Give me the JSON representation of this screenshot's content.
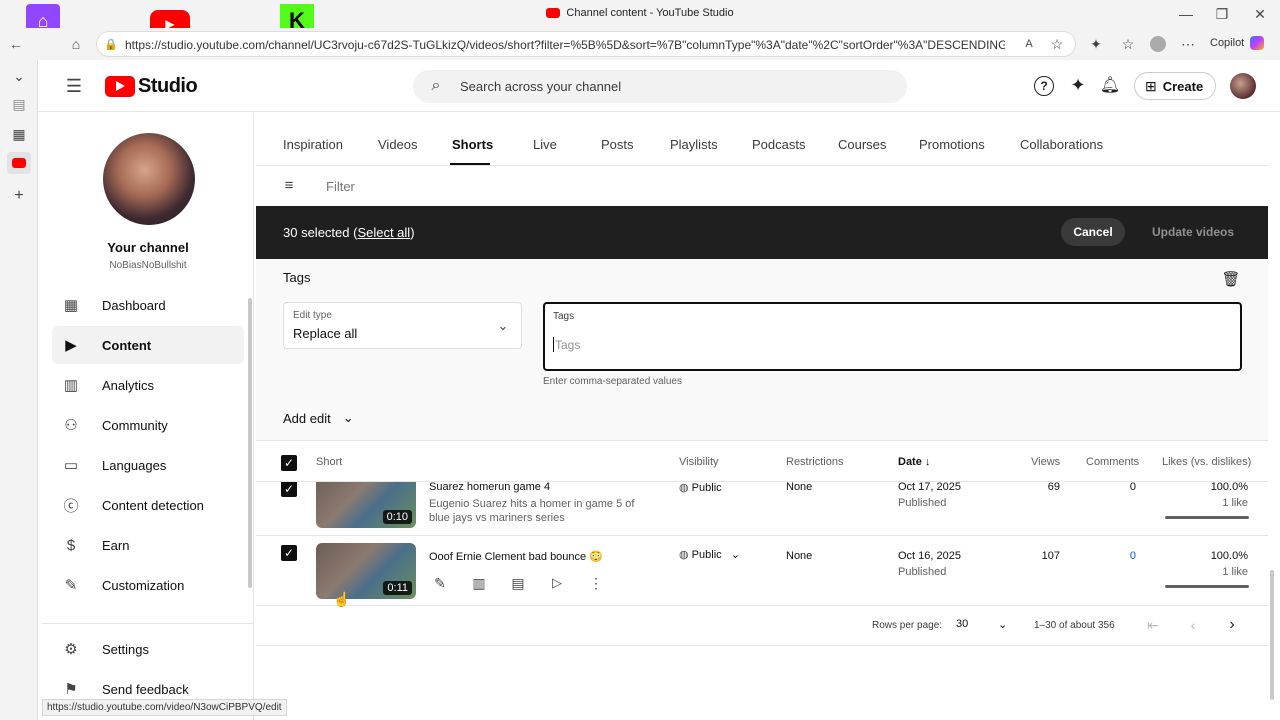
{
  "browser": {
    "window_title": "Channel content - YouTube Studio",
    "url": "https://studio.youtube.com/channel/UC3rvoju-c67d2S-TuGLkizQ/videos/short?filter=%5B%5D&sort=%7B\"columnType\"%3A\"date\"%2C\"sortOrder\"%3A\"DESCENDING\"%7D",
    "profile_label": "Copilot",
    "status_url": "https://studio.youtube.com/video/N3owCiPBPVQ/edit"
  },
  "header": {
    "logo_text": "Studio",
    "search_placeholder": "Search across your channel",
    "create_label": "Create"
  },
  "sidebar": {
    "channel_title": "Your channel",
    "channel_handle": "NoBiasNoBullshit",
    "items": [
      {
        "label": "Dashboard"
      },
      {
        "label": "Content"
      },
      {
        "label": "Analytics"
      },
      {
        "label": "Community"
      },
      {
        "label": "Languages"
      },
      {
        "label": "Content detection"
      },
      {
        "label": "Earn"
      },
      {
        "label": "Customization"
      }
    ],
    "settings_label": "Settings",
    "feedback_label": "Send feedback"
  },
  "tabs": [
    {
      "label": "Inspiration"
    },
    {
      "label": "Videos"
    },
    {
      "label": "Shorts"
    },
    {
      "label": "Live"
    },
    {
      "label": "Posts"
    },
    {
      "label": "Playlists"
    },
    {
      "label": "Podcasts"
    },
    {
      "label": "Courses"
    },
    {
      "label": "Promotions"
    },
    {
      "label": "Collaborations"
    }
  ],
  "filter": {
    "placeholder": "Filter"
  },
  "selection": {
    "count_text": "30 selected (",
    "select_all": "Select all",
    "close_paren": ")",
    "cancel_label": "Cancel",
    "update_label": "Update videos"
  },
  "edit_panel": {
    "heading": "Tags",
    "edit_type_label": "Edit type",
    "edit_type_value": "Replace all",
    "tags_label": "Tags",
    "tags_placeholder": "Tags",
    "helper": "Enter comma-separated values",
    "add_edit_label": "Add edit"
  },
  "table": {
    "headers": {
      "short": "Short",
      "visibility": "Visibility",
      "restrictions": "Restrictions",
      "date": "Date",
      "views": "Views",
      "comments": "Comments",
      "likes": "Likes (vs. dislikes)"
    },
    "rows": [
      {
        "title": "Suarez homerun game 4",
        "description": "Eugenio Suarez hits a homer in game 5 of blue jays vs mariners series",
        "duration": "0:10",
        "visibility": "Public",
        "restrictions": "None",
        "date": "Oct 17, 2025",
        "date_status": "Published",
        "views": "69",
        "comments": "0",
        "likes_pct": "100.0%",
        "likes_count": "1 like",
        "likes_ratio": 1.0
      },
      {
        "title": "Ooof Ernie Clement bad bounce 😳",
        "description": "",
        "duration": "0:11",
        "visibility": "Public",
        "restrictions": "None",
        "date": "Oct 16, 2025",
        "date_status": "Published",
        "views": "107",
        "comments": "0",
        "likes_pct": "100.0%",
        "likes_count": "1 like",
        "likes_ratio": 1.0
      }
    ]
  },
  "pagination": {
    "rows_label": "Rows per page:",
    "rows_value": "30",
    "range": "1–30 of about 356"
  },
  "colors": {
    "accent": "#065fd4",
    "youtube_red": "#ff0000",
    "dark_bar": "#1f1f1f"
  }
}
